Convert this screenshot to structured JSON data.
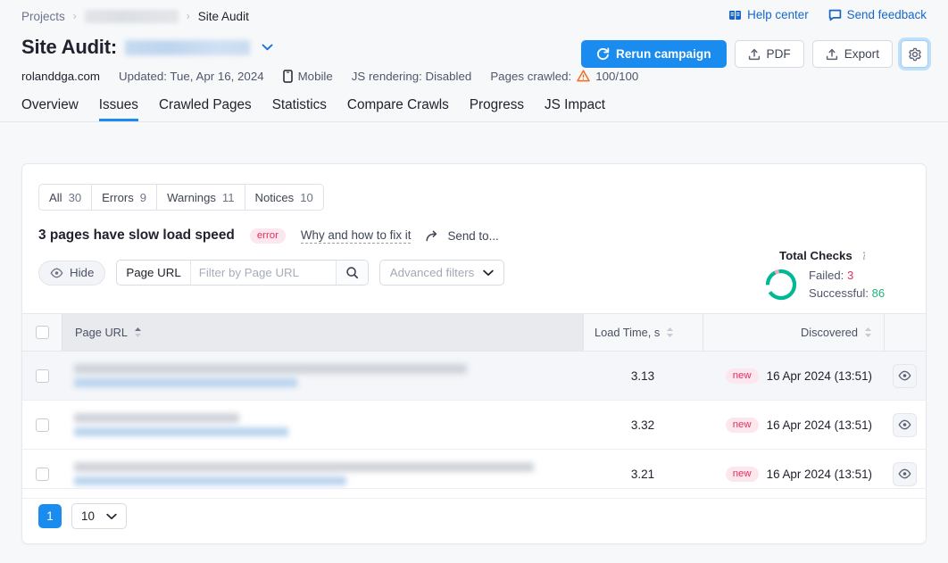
{
  "breadcrumb": {
    "root": "Projects",
    "project_redacted": "",
    "current": "Site Audit",
    "separator": "›"
  },
  "header": {
    "title_prefix": "Site Audit:",
    "campaign_redacted": "",
    "dropdown_caret": "⌄",
    "help_center": "Help center",
    "send_feedback": "Send feedback",
    "help_center_icon": "book-icon",
    "send_feedback_icon": "speech-bubble-icon"
  },
  "actions": {
    "rerun": "Rerun campaign",
    "rerun_icon": "refresh-icon",
    "pdf": "PDF",
    "export": "Export",
    "upload_icon": "upload-icon",
    "settings_icon": "gear-icon",
    "primary_color": "#1a8cf0"
  },
  "meta": {
    "domain": "rolanddga.com",
    "updated": "Updated: Tue, Apr 16, 2024",
    "device": "Mobile",
    "device_icon": "mobile-icon",
    "js_rendering": "JS rendering: Disabled",
    "pages_crawled_label": "Pages crawled:",
    "pages_crawled_value": "100/100",
    "warning_icon": "warning-triangle-icon"
  },
  "tabs": [
    {
      "label": "Overview",
      "active": false
    },
    {
      "label": "Issues",
      "active": true
    },
    {
      "label": "Crawled Pages",
      "active": false
    },
    {
      "label": "Statistics",
      "active": false
    },
    {
      "label": "Compare Crawls",
      "active": false
    },
    {
      "label": "Progress",
      "active": false
    },
    {
      "label": "JS Impact",
      "active": false
    }
  ],
  "filter_pills": [
    {
      "label": "All",
      "count": "30"
    },
    {
      "label": "Errors",
      "count": "9"
    },
    {
      "label": "Warnings",
      "count": "11"
    },
    {
      "label": "Notices",
      "count": "10"
    }
  ],
  "issue": {
    "title": "3 pages have slow load speed",
    "badge": "error",
    "badge_color": "#e0315f",
    "fix_link": "Why and how to fix it",
    "send_to": "Send to...",
    "send_to_icon": "share-arrow-icon"
  },
  "filters": {
    "hide_label": "Hide",
    "hide_icon": "eye-icon",
    "column_label": "Page URL",
    "search_placeholder": "Filter by Page URL",
    "search_value": "",
    "search_icon": "magnifier-icon",
    "advanced_label": "Advanced filters",
    "advanced_caret": "⌄"
  },
  "total_checks": {
    "title": "Total Checks",
    "info_icon": "info-icon",
    "failed_label": "Failed:",
    "failed_value": "3",
    "successful_label": "Successful:",
    "successful_value": "86",
    "failed_color": "#e0315f",
    "successful_color": "#24b47e"
  },
  "chart_data": {
    "type": "pie",
    "title": "Total Checks",
    "categories": [
      "Successful",
      "Failed"
    ],
    "values": [
      86,
      3
    ],
    "colors": [
      "#00b894",
      "#f7a6bd"
    ],
    "legend_position": "right",
    "donut": true
  },
  "table": {
    "columns": [
      {
        "key": "select",
        "label": ""
      },
      {
        "key": "page_url",
        "label": "Page URL",
        "sort": "asc",
        "sort_icon": "sort-ascending-icon"
      },
      {
        "key": "load_time",
        "label": "Load Time, s",
        "sort": "none",
        "sort_icon": "sort-icon"
      },
      {
        "key": "discovered",
        "label": "Discovered",
        "sort": "none",
        "sort_icon": "sort-icon"
      },
      {
        "key": "actions",
        "label": ""
      }
    ],
    "rows": [
      {
        "page_url": "",
        "load_time": "3.13",
        "badge": "new",
        "discovered": "16 Apr 2024 (13:51)",
        "action_icon": "eye-icon"
      },
      {
        "page_url": "",
        "load_time": "3.32",
        "badge": "new",
        "discovered": "16 Apr 2024 (13:51)",
        "action_icon": "eye-icon"
      },
      {
        "page_url": "",
        "load_time": "3.21",
        "badge": "new",
        "discovered": "16 Apr 2024 (13:51)",
        "action_icon": "eye-icon"
      }
    ]
  },
  "pagination": {
    "current_page": "1",
    "per_page": "10",
    "caret": "⌄"
  }
}
